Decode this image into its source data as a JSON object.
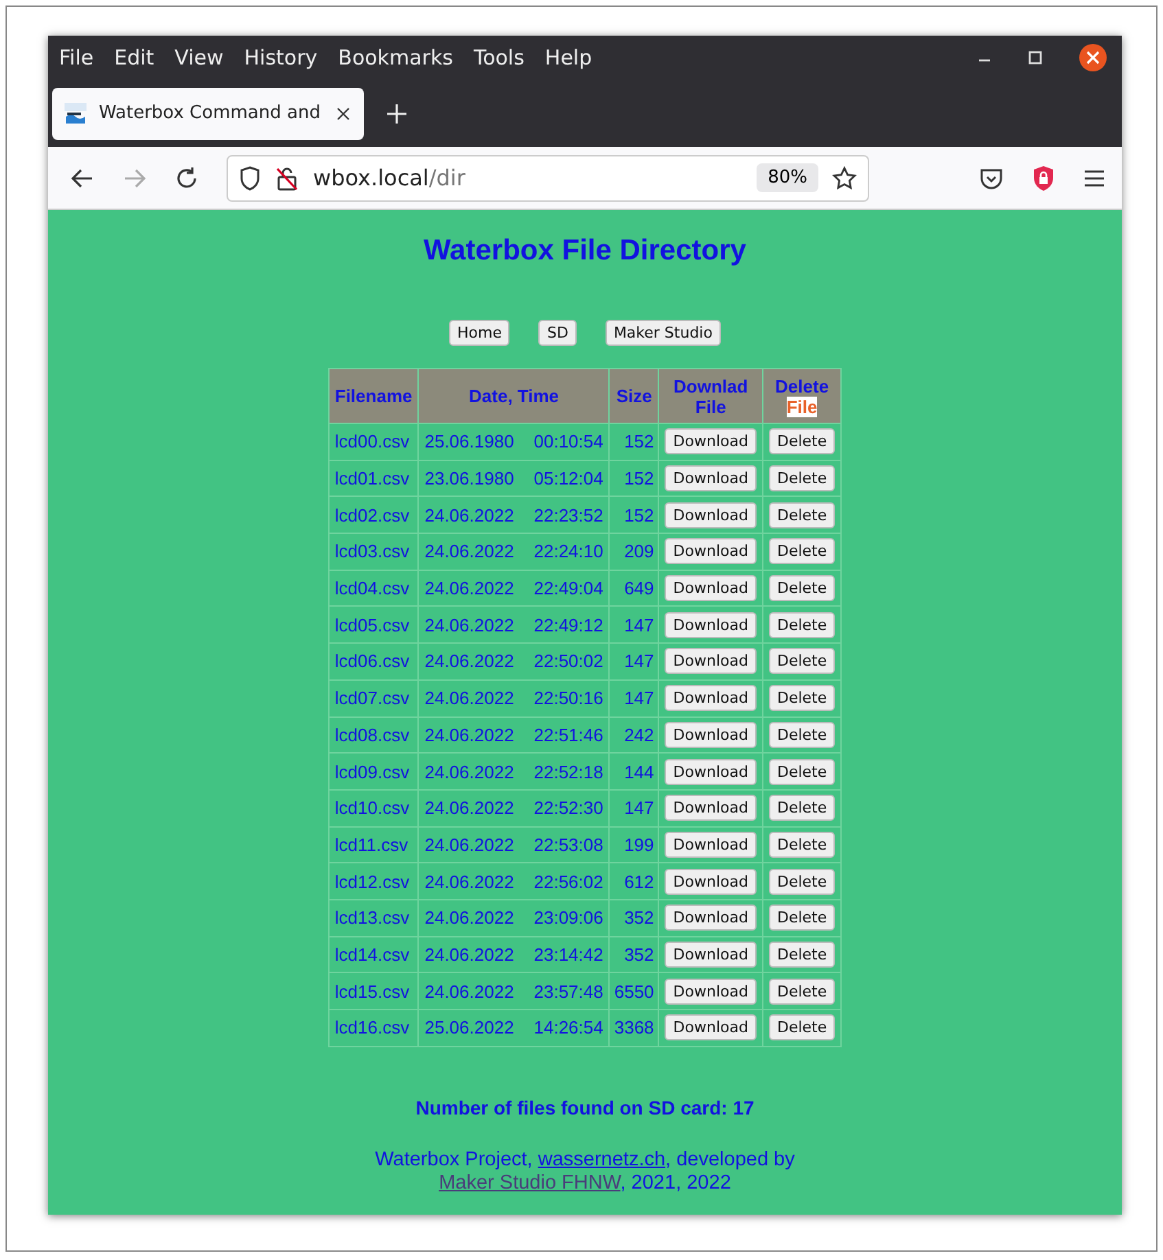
{
  "browser": {
    "menu": [
      {
        "label": "File"
      },
      {
        "label": "Edit"
      },
      {
        "label": "View"
      },
      {
        "label": "History"
      },
      {
        "label": "Bookmarks"
      },
      {
        "label": "Tools"
      },
      {
        "label": "Help"
      }
    ],
    "tabs": [
      {
        "title": "Waterbox Command and",
        "selected": true
      }
    ],
    "address": {
      "host": "wbox.local",
      "path": "/dir"
    },
    "zoom": "80%"
  },
  "page": {
    "title": "Waterbox File Directory",
    "nav_buttons": [
      "Home",
      "SD",
      "Maker Studio"
    ],
    "table": {
      "columns": [
        {
          "text": "Filename"
        },
        {
          "text": "Date, Time"
        },
        {
          "text": "Size"
        },
        {
          "text": "Downlad File"
        },
        {
          "text": "Delete",
          "highlight": "File"
        }
      ],
      "rows": [
        {
          "filename": "lcd00.csv",
          "date": "25.06.1980",
          "time": "00:10:54",
          "size": "152",
          "download": "Download",
          "delete": "Delete"
        },
        {
          "filename": "lcd01.csv",
          "date": "23.06.1980",
          "time": "05:12:04",
          "size": "152",
          "download": "Download",
          "delete": "Delete"
        },
        {
          "filename": "lcd02.csv",
          "date": "24.06.2022",
          "time": "22:23:52",
          "size": "152",
          "download": "Download",
          "delete": "Delete"
        },
        {
          "filename": "lcd03.csv",
          "date": "24.06.2022",
          "time": "22:24:10",
          "size": "209",
          "download": "Download",
          "delete": "Delete"
        },
        {
          "filename": "lcd04.csv",
          "date": "24.06.2022",
          "time": "22:49:04",
          "size": "649",
          "download": "Download",
          "delete": "Delete"
        },
        {
          "filename": "lcd05.csv",
          "date": "24.06.2022",
          "time": "22:49:12",
          "size": "147",
          "download": "Download",
          "delete": "Delete"
        },
        {
          "filename": "lcd06.csv",
          "date": "24.06.2022",
          "time": "22:50:02",
          "size": "147",
          "download": "Download",
          "delete": "Delete"
        },
        {
          "filename": "lcd07.csv",
          "date": "24.06.2022",
          "time": "22:50:16",
          "size": "147",
          "download": "Download",
          "delete": "Delete"
        },
        {
          "filename": "lcd08.csv",
          "date": "24.06.2022",
          "time": "22:51:46",
          "size": "242",
          "download": "Download",
          "delete": "Delete"
        },
        {
          "filename": "lcd09.csv",
          "date": "24.06.2022",
          "time": "22:52:18",
          "size": "144",
          "download": "Download",
          "delete": "Delete"
        },
        {
          "filename": "lcd10.csv",
          "date": "24.06.2022",
          "time": "22:52:30",
          "size": "147",
          "download": "Download",
          "delete": "Delete"
        },
        {
          "filename": "lcd11.csv",
          "date": "24.06.2022",
          "time": "22:53:08",
          "size": "199",
          "download": "Download",
          "delete": "Delete"
        },
        {
          "filename": "lcd12.csv",
          "date": "24.06.2022",
          "time": "22:56:02",
          "size": "612",
          "download": "Download",
          "delete": "Delete"
        },
        {
          "filename": "lcd13.csv",
          "date": "24.06.2022",
          "time": "23:09:06",
          "size": "352",
          "download": "Download",
          "delete": "Delete"
        },
        {
          "filename": "lcd14.csv",
          "date": "24.06.2022",
          "time": "23:14:42",
          "size": "352",
          "download": "Download",
          "delete": "Delete"
        },
        {
          "filename": "lcd15.csv",
          "date": "24.06.2022",
          "time": "23:57:48",
          "size": "6550",
          "download": "Download",
          "delete": "Delete"
        },
        {
          "filename": "lcd16.csv",
          "date": "25.06.2022",
          "time": "14:26:54",
          "size": "3368",
          "download": "Download",
          "delete": "Delete"
        }
      ]
    },
    "file_count": "Number of files found on SD card: 17",
    "footer": [
      {
        "kind": "text",
        "text": "Waterbox Project, "
      },
      {
        "kind": "link",
        "text": "wassernetz.ch"
      },
      {
        "kind": "text",
        "text": ", developed by "
      },
      {
        "kind": "link",
        "text": "Maker Studio FHNW"
      },
      {
        "kind": "text",
        "text": ", 2021, 2022"
      }
    ]
  }
}
